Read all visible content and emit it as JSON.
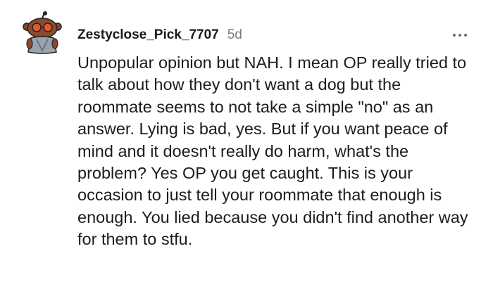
{
  "comment": {
    "author": "Zestyclose_Pick_7707",
    "age": "5d",
    "avatar_icon": "snoo-avatar-icon",
    "more_icon": "more-options-icon",
    "body": "Unpopular opinion but NAH. I mean OP really tried to talk about how they don't want a dog but the roommate seems to not take a simple \"no\" as an answer. Lying is bad, yes. But if you want peace of mind and it doesn't really do harm, what's the problem? Yes OP you get caught. This is your occasion to just tell your roommate that enough is enough. You lied because you didn't find another way for them to stfu."
  },
  "colors": {
    "author": "#1a1a1b",
    "timestamp": "#7c7c7c",
    "body": "#1c1c1c",
    "avatar_skin": "#8a4a2c",
    "avatar_glasses": "#e05a2b",
    "avatar_robe": "#9aa3ad"
  }
}
